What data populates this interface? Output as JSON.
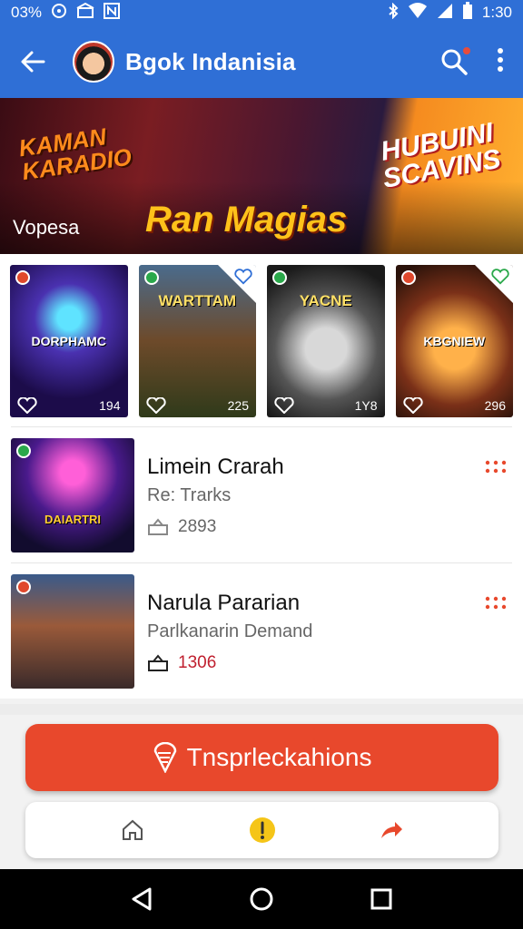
{
  "status_bar": {
    "left_text": "03%",
    "time": "1:30"
  },
  "app_bar": {
    "title": "Bgok Indanisia"
  },
  "banner": {
    "left_title": "KAMAN KARADIO",
    "right_title": "HUBUINI SCAVINS",
    "label": "Vopesa",
    "main_title": "Ran Magias"
  },
  "cards": [
    {
      "title": "DORPHAMC",
      "count": "194"
    },
    {
      "title": "WARTTAM",
      "count": "225"
    },
    {
      "title": "YACNE",
      "count": "1Y8"
    },
    {
      "title": "KBGNIEW",
      "count": "296"
    }
  ],
  "list": [
    {
      "title": "Limein Crarah",
      "subtitle": "Re: Trarks",
      "meta": "2893",
      "thumb_label": "DAIARTRI"
    },
    {
      "title": "Narula Pararian",
      "subtitle": "Parlkanarin Demand",
      "meta": "1306"
    }
  ],
  "cta": {
    "label": "Tnsprleckahions"
  },
  "colors": {
    "app_bar": "#2f6fd6",
    "cta": "#e8482c",
    "meta_red": "#c0202f"
  }
}
